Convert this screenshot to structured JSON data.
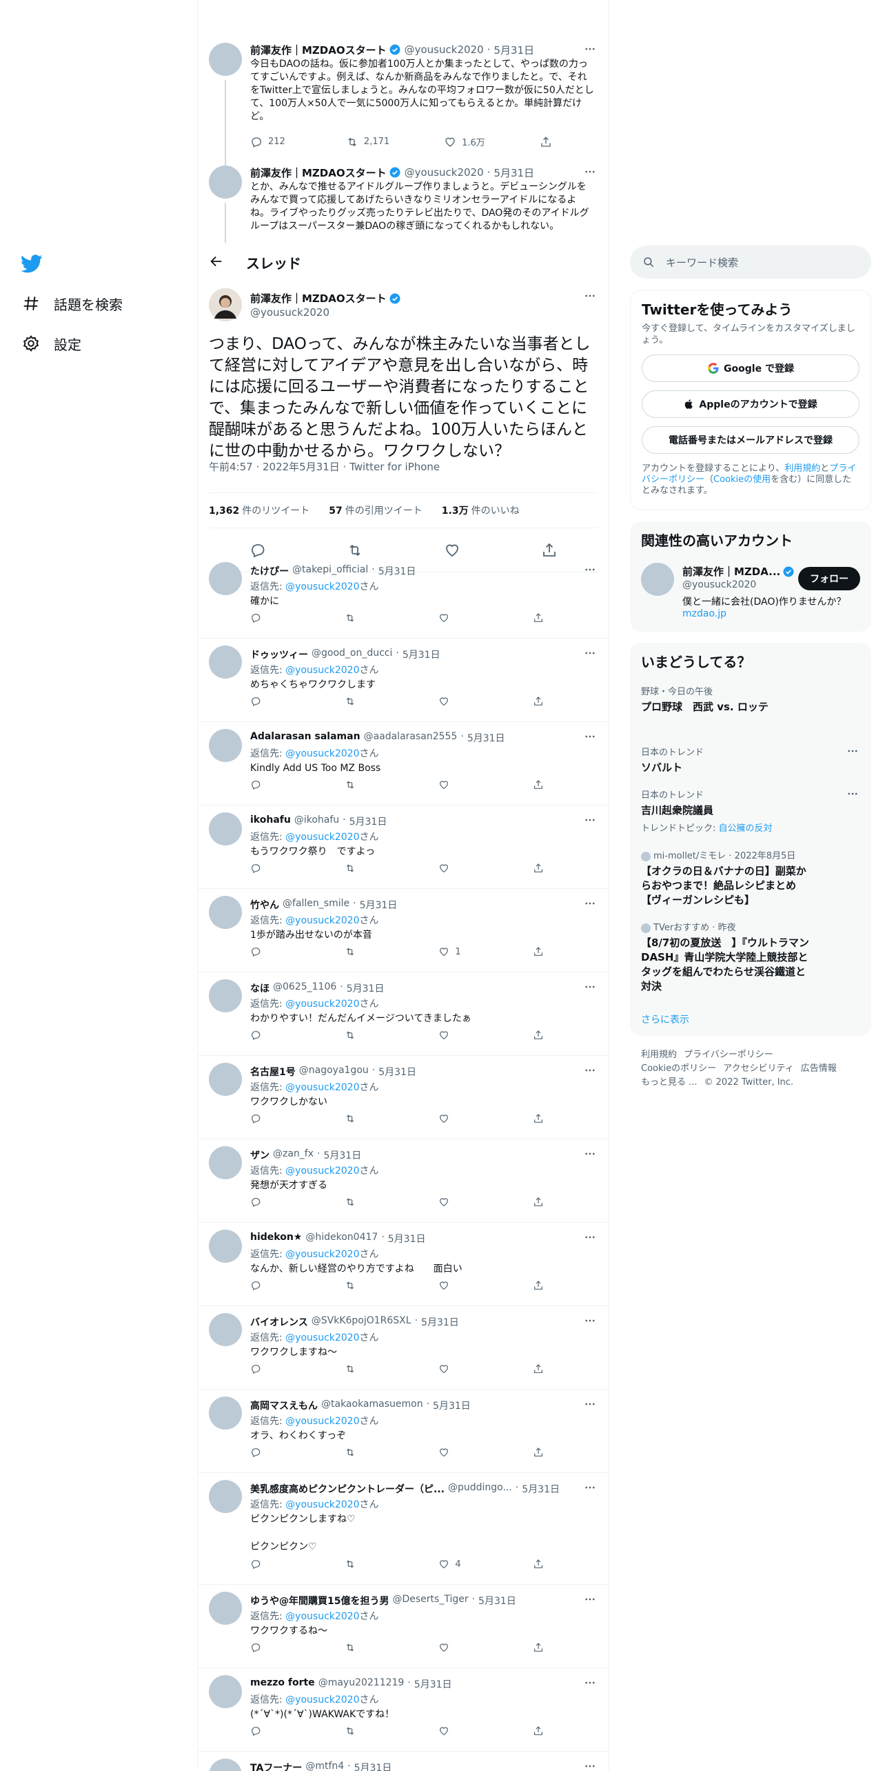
{
  "nav": {
    "explore": "話題を検索",
    "settings": "設定"
  },
  "prev_tweets": [
    {
      "name": "前澤友作｜MZDAOスタート",
      "handle": "@yousuck2020",
      "date": "5月31日",
      "text": "今日もDAOの話ね。仮に参加者100万人とか集まったとして、やっぱ数の力ってすごいんですよ。例えば、なんか新商品をみんなで作りましたと。で、それをTwitter上で宣伝しましょうと。みんなの平均フォロワー数が仮に50人だとして、100万人×50人で一気に5000万人に知ってもらえるとか。単純計算だけど。",
      "replies": "212",
      "retweets": "2,171",
      "likes": "1.6万"
    },
    {
      "name": "前澤友作｜MZDAOスタート",
      "handle": "@yousuck2020",
      "date": "5月31日",
      "text": "とか、みんなで推せるアイドルグループ作りましょうと。デビューシングルをみんなで買って応援してあげたらいきなりミリオンセラーアイドルになるよね。ライブやったりグッズ売ったりテレビ出たりで、DAO発のそのアイドルグループはスーパースター兼DAOの稼ぎ頭になってくれるかもしれない。"
    }
  ],
  "thread_header": {
    "title": "スレッド"
  },
  "focal": {
    "name": "前澤友作｜MZDAOスタート",
    "handle": "@yousuck2020",
    "text": "つまり、DAOって、みんなが株主みたいな当事者として経営に対してアイデアや意見を出し合いながら、時には応援に回るユーザーや消費者になったりすることで、集まったみんなで新しい価値を作っていくことに醍醐味があると思うんだよね。100万人いたらほんとに世の中動かせるから。ワクワクしない？",
    "meta": "午前4:57 · 2022年5月31日 · Twitter for iPhone",
    "retweets_num": "1,362",
    "retweets_label": "件のリツイート",
    "quotes_num": "57",
    "quotes_label": "件の引用ツイート",
    "likes_num": "1.3万",
    "likes_label": "件のいいね"
  },
  "reply_prefix": "返信先: ",
  "reply_suffix": "さん",
  "reply_target": "@yousuck2020",
  "replies": [
    {
      "name": "たけぴー",
      "handle": "@takepi_official",
      "date": "5月31日",
      "text": "確かに",
      "likes": ""
    },
    {
      "name": "ドゥッツィー",
      "handle": "@good_on_ducci",
      "date": "5月31日",
      "text": "めちゃくちゃワクワクします",
      "likes": ""
    },
    {
      "name": "Adalarasan salaman",
      "handle": "@aadalarasan2555",
      "date": "5月31日",
      "text": "Kindly Add US Too MZ Boss",
      "likes": ""
    },
    {
      "name": "ikohafu",
      "handle": "@ikohafu",
      "date": "5月31日",
      "text": "もうワクワク祭り　ですよっ",
      "likes": ""
    },
    {
      "name": "竹やん",
      "handle": "@fallen_smile",
      "date": "5月31日",
      "text": "1歩が踏み出せないのが本音",
      "likes": "1"
    },
    {
      "name": "なほ",
      "handle": "@0625_1106",
      "date": "5月31日",
      "text": "わかりやすい！だんだんイメージついてきましたぁ",
      "likes": ""
    },
    {
      "name": "名古屋1号",
      "handle": "@nagoya1gou",
      "date": "5月31日",
      "text": "ワクワクしかない",
      "likes": ""
    },
    {
      "name": "ザン",
      "handle": "@zan_fx",
      "date": "5月31日",
      "text": "発想が天才すぎる",
      "likes": ""
    },
    {
      "name": "hidekon★",
      "handle": "@hidekon0417",
      "date": "5月31日",
      "text": "なんか、新しい経営のやり方ですよね　　面白い",
      "likes": ""
    },
    {
      "name": "バイオレンス",
      "handle": "@SVkK6pojO1R6SXL",
      "date": "5月31日",
      "text": "ワクワクしますね〜",
      "likes": ""
    },
    {
      "name": "高岡マスえもん",
      "handle": "@takaokamasuemon",
      "date": "5月31日",
      "text": "オラ、わくわくすっぞ",
      "likes": ""
    },
    {
      "name": "美乳感度高めピクンピクントレーダー（ピ...",
      "handle": "@puddingo...",
      "date": "5月31日",
      "text": "ピクンピクンしますね♡\n\nピクンピクン♡",
      "likes": "4"
    },
    {
      "name": "ゆうや@年間購買15億を担う男",
      "handle": "@Deserts_Tiger",
      "date": "5月31日",
      "text": "ワクワクするね〜",
      "likes": ""
    },
    {
      "name": "mezzo forte",
      "handle": "@mayu20211219",
      "date": "5月31日",
      "text": "(*´∀`*)(*´∀`)WAKWAKですね！",
      "likes": ""
    },
    {
      "name": "TAフーナー",
      "handle": "@mtfn4",
      "date": "5月31日",
      "text": "",
      "likes": ""
    }
  ],
  "search": {
    "placeholder": "キーワード検索"
  },
  "signup": {
    "title": "Twitterを使ってみよう",
    "subtitle": "今すぐ登録して、タイムラインをカスタマイズしましょう。",
    "google": "Google で登録",
    "apple": "Appleのアカウントで登録",
    "phone": "電話番号またはメールアドレスで登録",
    "terms_pre": "アカウントを登録することにより、",
    "terms_link1": "利用規約",
    "terms_mid1": "と",
    "terms_link2": "プライバシーポリシー",
    "terms_mid2": "（",
    "terms_link3": "Cookieの使用",
    "terms_post": "を含む）に同意したとみなされます。"
  },
  "related": {
    "title": "関連性の高いアカウント",
    "name": "前澤友作｜MZDA...",
    "handle": "@yousuck2020",
    "follow": "フォロー",
    "bio": "僕と一緒に会社(DAO)作りませんか？",
    "link": "mzdao.jp"
  },
  "trends": {
    "title": "いまどうしてる？",
    "items": [
      {
        "cat": "野球・今日の午後",
        "title": "プロ野球　西武 vs. ロッテ",
        "topic_label": "",
        "topic": ""
      },
      {
        "cat": "日本のトレンド",
        "title": "ソバルト",
        "topic_label": "",
        "topic": ""
      },
      {
        "cat": "日本のトレンド",
        "title": "吉川赳衆院議員",
        "topic_label": "トレンドトピック: ",
        "topic": "自公擁の反対"
      },
      {
        "cat": "mi-mollet/ミモレ · 2022年8月5日",
        "title": "【オクラの日＆バナナの日】副菜からおやつまで！絶品レシピまとめ【ヴィーガンレシピも】",
        "topic_label": "",
        "topic": ""
      },
      {
        "cat": "TVerおすすめ · 昨夜",
        "title": "【8/7初の夏放送　】『ウルトラマンDASH』青山学院大学陸上競技部とタッグを組んでわたらせ渓谷鐵道と対決",
        "topic_label": "",
        "topic": ""
      }
    ],
    "show_more": "さらに表示"
  },
  "footer": {
    "l1": "利用規約",
    "l2": "プライバシーポリシー",
    "l3": "Cookieのポリシー",
    "l4": "アクセシビリティ",
    "l5": "広告情報",
    "l6": "もっと見る ...",
    "l7": "© 2022 Twitter, Inc."
  },
  "colors": {
    "accent": "#1d9bf0",
    "text": "#0f1419",
    "muted": "#536471"
  }
}
